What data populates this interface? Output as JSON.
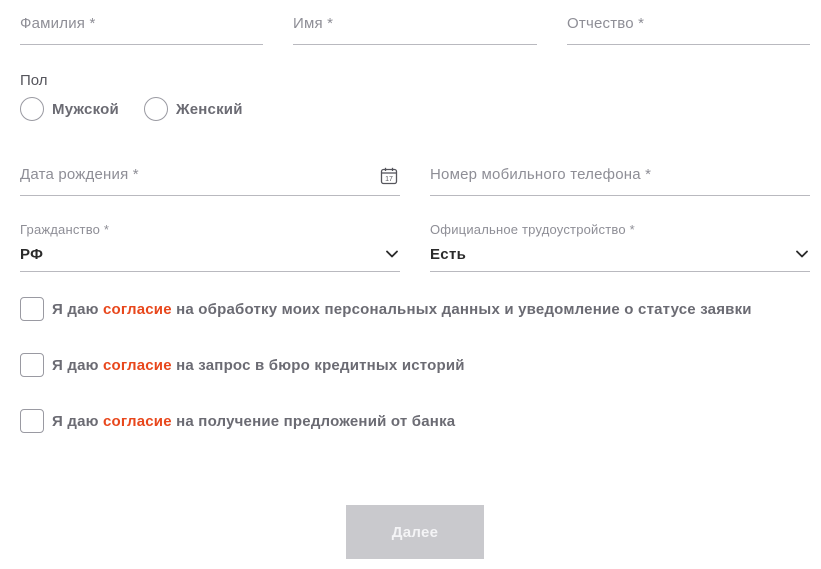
{
  "form": {
    "last_name": {
      "placeholder": "Фамилия *"
    },
    "first_name": {
      "placeholder": "Имя *"
    },
    "middle_name": {
      "placeholder": "Отчество *"
    },
    "gender": {
      "label": "Пол",
      "options": [
        "Мужской",
        "Женский"
      ]
    },
    "birth_date": {
      "placeholder": "Дата рождения *",
      "icon": "calendar-icon",
      "icon_text": "17"
    },
    "phone": {
      "placeholder": "Номер мобильного телефона *"
    },
    "citizenship": {
      "label": "Гражданство *",
      "value": "РФ",
      "icon": "chevron-down-icon"
    },
    "employment": {
      "label": "Официальное трудоустройство *",
      "value": "Есть",
      "icon": "chevron-down-icon"
    },
    "consents": [
      {
        "prefix": "Я даю ",
        "link": "согласие",
        "suffix": " на обработку моих персональных данных и уведомление о статусе заявки"
      },
      {
        "prefix": "Я даю ",
        "link": "согласие",
        "suffix": " на запрос в бюро кредитных историй"
      },
      {
        "prefix": "Я даю ",
        "link": "согласие",
        "suffix": " на получение предложений от банка"
      }
    ],
    "submit_label": "Далее"
  },
  "colors": {
    "accent": "#e8471c",
    "button_disabled": "#c9c9cd",
    "line": "#b9b9bf",
    "placeholder": "#8e8e96"
  }
}
